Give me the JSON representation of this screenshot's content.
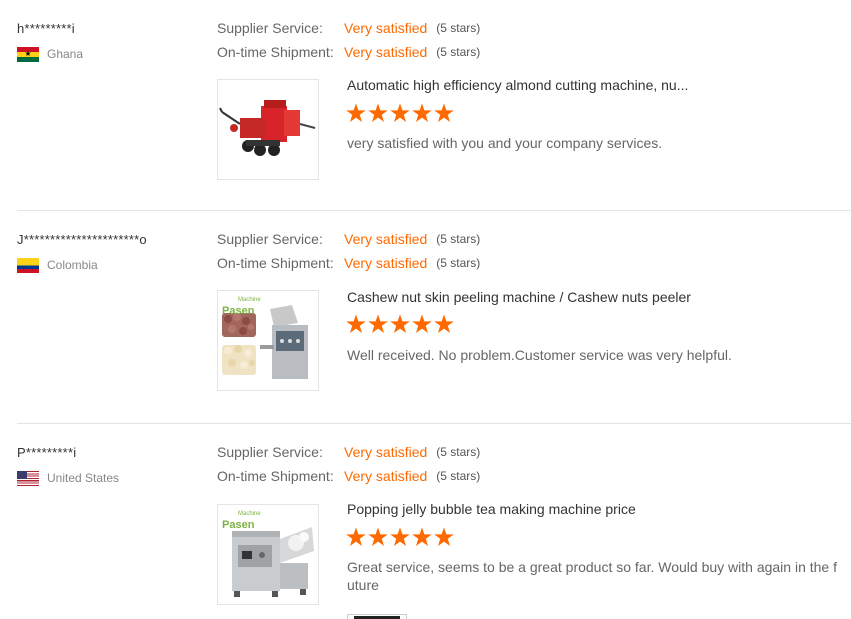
{
  "reviews": [
    {
      "buyer": "h*********i",
      "country": "Ghana",
      "flag_icon": "ghana-flag-icon",
      "supplier_service_label": "Supplier Service:",
      "supplier_service_value": "Very satisfied",
      "supplier_service_stars": "(5 stars)",
      "shipment_label": "On-time Shipment:",
      "shipment_value": "Very satisfied",
      "shipment_stars": "(5 stars)",
      "product_title": "Automatic high efficiency almond cutting machine, nu...",
      "rating": 5,
      "comment": "very satisfied with you and your company services."
    },
    {
      "buyer": "J**********************o",
      "country": "Colombia",
      "flag_icon": "colombia-flag-icon",
      "supplier_service_label": "Supplier Service:",
      "supplier_service_value": "Very satisfied",
      "supplier_service_stars": "(5 stars)",
      "shipment_label": "On-time Shipment:",
      "shipment_value": "Very satisfied",
      "shipment_stars": "(5 stars)",
      "product_title": "Cashew nut skin peeling machine / Cashew nuts peeler",
      "rating": 5,
      "comment": "Well received. No problem.Customer service was very helpful.",
      "brand": "Pasen",
      "brand_sub": "Machine"
    },
    {
      "buyer": "P*********i",
      "country": "United States",
      "flag_icon": "usa-flag-icon",
      "supplier_service_label": "Supplier Service:",
      "supplier_service_value": "Very satisfied",
      "supplier_service_stars": "(5 stars)",
      "shipment_label": "On-time Shipment:",
      "shipment_value": "Very satisfied",
      "shipment_stars": "(5 stars)",
      "product_title": "Popping jelly bubble tea making machine price",
      "rating": 5,
      "comment": "Great service, seems to be a great product so far. Would buy with again in the f uture",
      "brand": "Pasen",
      "brand_sub": "Machine"
    }
  ],
  "colors": {
    "accent": "#ff6a00",
    "label": "#666666",
    "divider": "#e3e3e3"
  }
}
